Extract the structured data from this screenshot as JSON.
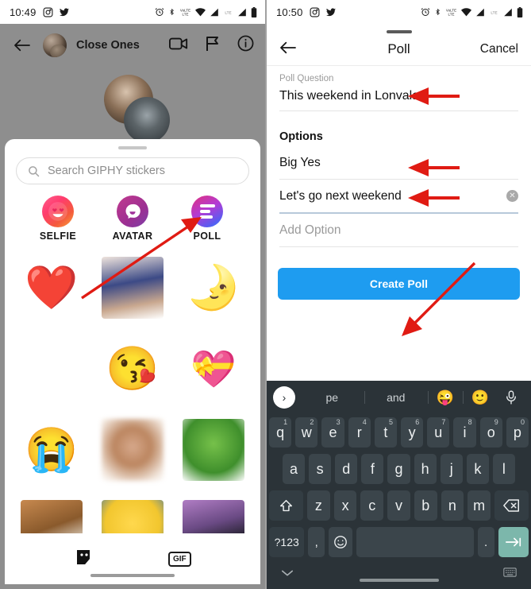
{
  "left_panel": {
    "status_bar": {
      "time": "10:49",
      "left_icons": [
        "instagram-icon",
        "twitter-icon"
      ],
      "right_icons": [
        "alarm-icon",
        "bluetooth-icon",
        "volte-icon",
        "wifi-icon",
        "signal-icon",
        "lte-icon",
        "signal-2-icon",
        "battery-icon"
      ]
    },
    "chat_header": {
      "back_label": "back-arrow",
      "title": "Close Ones",
      "actions": [
        "video-call-icon",
        "flag-icon",
        "info-icon"
      ]
    },
    "sticker_sheet": {
      "search_placeholder": "Search GIPHY stickers",
      "categories": [
        {
          "label": "SELFIE",
          "icon": "selfie-sticker-icon"
        },
        {
          "label": "AVATAR",
          "icon": "avatar-sticker-icon"
        },
        {
          "label": "POLL",
          "icon": "poll-sticker-icon"
        }
      ],
      "stickers": [
        {
          "name": "red-heart-sticker",
          "glyph": "❤️",
          "kind": "emoji"
        },
        {
          "name": "woman-photo-sticker",
          "glyph": "",
          "kind": "image",
          "style": "im-girl"
        },
        {
          "name": "moon-and-star-sticker",
          "glyph": "🌛",
          "kind": "emoji"
        },
        {
          "name": "blank-sticker-1",
          "glyph": "",
          "kind": "blank"
        },
        {
          "name": "kissing-face-sticker",
          "glyph": "😘",
          "kind": "emoji"
        },
        {
          "name": "hanging-hearts-sticker",
          "glyph": "💝",
          "kind": "emoji"
        },
        {
          "name": "loudly-crying-sticker",
          "glyph": "😭",
          "kind": "emoji"
        },
        {
          "name": "blurred-photo-sticker",
          "glyph": "",
          "kind": "image",
          "style": "im-blur"
        },
        {
          "name": "frog-dancing-sticker",
          "glyph": "",
          "kind": "image",
          "style": "im-kermit"
        },
        {
          "name": "bear-clock-sticker",
          "glyph": "",
          "kind": "image",
          "style": "im-bear"
        },
        {
          "name": "heart-eyes-minion-sticker",
          "glyph": "",
          "kind": "image",
          "style": "im-minion"
        },
        {
          "name": "count-vampire-sticker",
          "glyph": "",
          "kind": "image",
          "style": "im-count"
        }
      ],
      "footer": {
        "sticker_tab": "sticker-face-icon",
        "gif_tab": "GIF"
      }
    }
  },
  "right_panel": {
    "status_bar": {
      "time": "10:50",
      "left_icons": [
        "instagram-icon",
        "twitter-icon"
      ],
      "right_icons": [
        "alarm-icon",
        "bluetooth-icon",
        "volte-icon",
        "wifi-icon",
        "signal-icon",
        "lte-icon",
        "signal-2-icon",
        "battery-icon"
      ]
    },
    "header": {
      "back_label": "back-arrow",
      "title": "Poll",
      "cancel_label": "Cancel"
    },
    "form": {
      "question_label": "Poll Question",
      "question_value": "This weekend in Lonvala?",
      "options_title": "Options",
      "options": [
        {
          "value": "Big Yes",
          "has_clear": false
        },
        {
          "value": "Let's go next weekend",
          "has_clear": true
        }
      ],
      "add_option_placeholder": "Add Option",
      "submit_label": "Create Poll",
      "submit_color": "#1E9CF0"
    },
    "keyboard": {
      "suggestions": [
        "pe",
        "and"
      ],
      "suggestion_emojis": [
        "😜",
        "🙂"
      ],
      "mic_icon": "microphone-icon",
      "expand_icon": "chevron-right-icon",
      "row1": [
        {
          "k": "q",
          "n": "1"
        },
        {
          "k": "w",
          "n": "2"
        },
        {
          "k": "e",
          "n": "3"
        },
        {
          "k": "r",
          "n": "4"
        },
        {
          "k": "t",
          "n": "5"
        },
        {
          "k": "y",
          "n": "6"
        },
        {
          "k": "u",
          "n": "7"
        },
        {
          "k": "i",
          "n": "8"
        },
        {
          "k": "o",
          "n": "9"
        },
        {
          "k": "p",
          "n": "0"
        }
      ],
      "row2": [
        "a",
        "s",
        "d",
        "f",
        "g",
        "h",
        "j",
        "k",
        "l"
      ],
      "row3": [
        "z",
        "x",
        "c",
        "v",
        "b",
        "n",
        "m"
      ],
      "shift_key": "shift-icon",
      "backspace_key": "backspace-icon",
      "symbols_key": "?123",
      "comma_key": ",",
      "emoji_key": "emoji-icon",
      "space_key": "",
      "period_key": ".",
      "enter_key": "enter-icon",
      "hide_keyboard_icon": "chevron-down-icon",
      "switch_keyboard_icon": "keyboard-switch-icon",
      "enter_color": "#7cb7ab",
      "background_color": "#2b3338"
    }
  },
  "annotations": {
    "arrow_color": "#e01b13",
    "arrows": [
      {
        "name": "arrow-to-poll-sticker",
        "points_to": "POLL"
      },
      {
        "name": "arrow-to-poll-question",
        "points_to": "This weekend in Lonvala?"
      },
      {
        "name": "arrow-to-option-1",
        "points_to": "Big Yes"
      },
      {
        "name": "arrow-to-option-2",
        "points_to": "Let's go next weekend"
      },
      {
        "name": "arrow-to-create-poll",
        "points_to": "Create Poll"
      }
    ]
  }
}
